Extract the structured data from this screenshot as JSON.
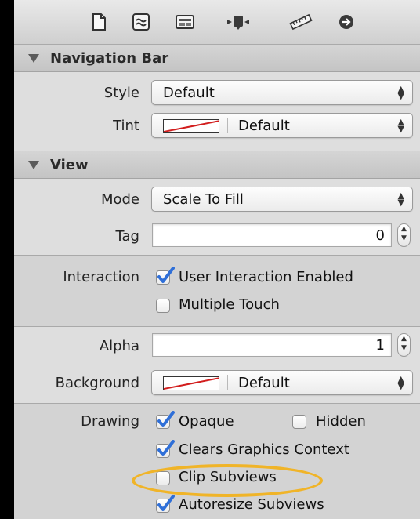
{
  "toolbar": {
    "icons": [
      "file-inspector-icon",
      "quick-help-icon",
      "identity-inspector-icon",
      "attributes-inspector-icon",
      "size-inspector-icon",
      "connections-inspector-icon"
    ],
    "selected": "attributes-inspector-icon"
  },
  "navigation_bar": {
    "title": "Navigation Bar",
    "style_label": "Style",
    "style_value": "Default",
    "tint_label": "Tint",
    "tint_value": "Default"
  },
  "view": {
    "title": "View",
    "mode_label": "Mode",
    "mode_value": "Scale To Fill",
    "tag_label": "Tag",
    "tag_value": "0",
    "interaction_label": "Interaction",
    "user_interaction_label": "User Interaction Enabled",
    "user_interaction_checked": true,
    "multiple_touch_label": "Multiple Touch",
    "multiple_touch_checked": false,
    "alpha_label": "Alpha",
    "alpha_value": "1",
    "background_label": "Background",
    "background_value": "Default",
    "drawing_label": "Drawing",
    "opaque_label": "Opaque",
    "opaque_checked": true,
    "hidden_label": "Hidden",
    "hidden_checked": false,
    "clears_label": "Clears Graphics Context",
    "clears_checked": true,
    "clip_label": "Clip Subviews",
    "clip_checked": false,
    "autoresize_label": "Autoresize Subviews",
    "autoresize_checked": true
  },
  "colors": {
    "highlight": "#f0b428",
    "check": "#2f6fd8",
    "swatch_line": "#d21d1d"
  }
}
